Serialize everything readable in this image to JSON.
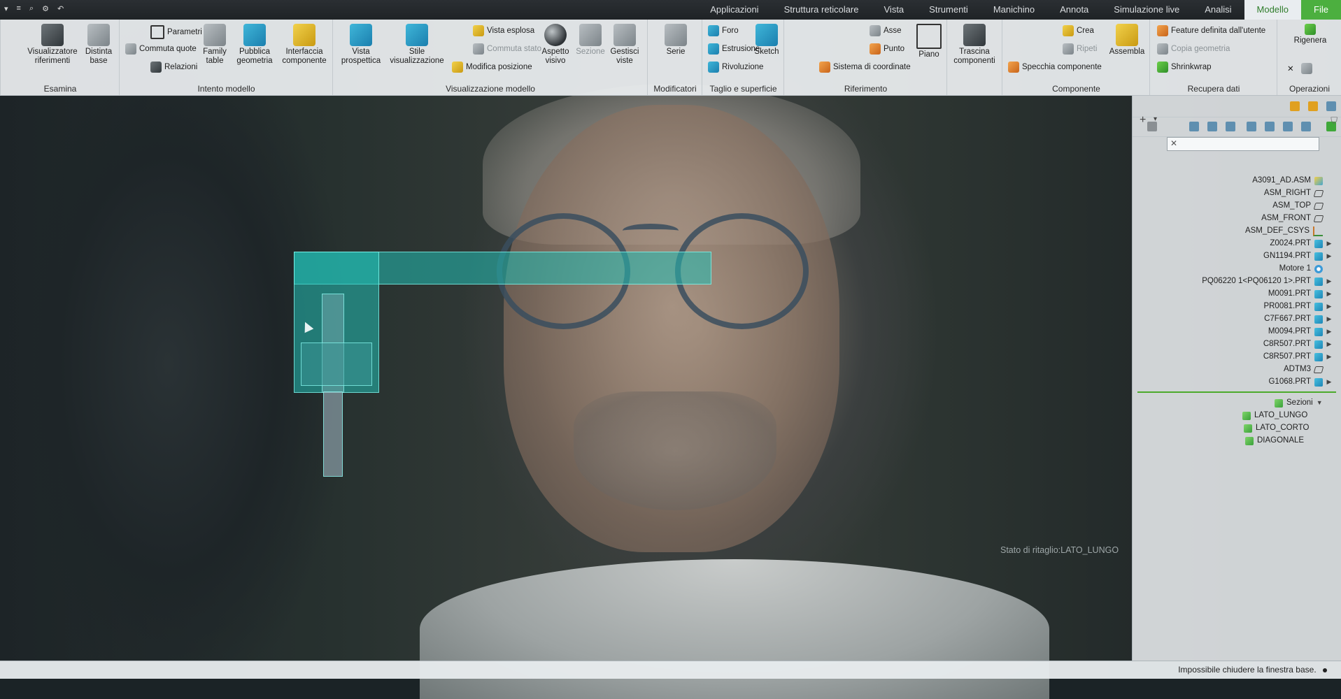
{
  "quick_access": {
    "icons": [
      "chevron-icon",
      "menu-icon",
      "search-icon",
      "settings-icon",
      "undo-icon"
    ]
  },
  "tabs": [
    {
      "label": "File",
      "state": "file"
    },
    {
      "label": "Modello",
      "state": "active"
    },
    {
      "label": "Analisi"
    },
    {
      "label": "Simulazione live"
    },
    {
      "label": "Annota"
    },
    {
      "label": "Manichino"
    },
    {
      "label": "Strumenti"
    },
    {
      "label": "Vista"
    },
    {
      "label": "Struttura reticolare"
    },
    {
      "label": "Applicazioni"
    }
  ],
  "ribbon": {
    "operazioni": {
      "label": "Operazioni",
      "rigenera": "Rigenera"
    },
    "recupera_dati": {
      "label": "Recupera dati",
      "feature_utente": "Feature definita dall'utente",
      "copia_geometria": "Copia geometria",
      "shrinkwrap": "Shrinkwrap"
    },
    "componente": {
      "label": "Componente",
      "assembla": "Assembla",
      "crea": "Crea",
      "ripeti": "Ripeti",
      "specchia": "Specchia componente",
      "trascina": "Trascina componenti"
    },
    "riferimento": {
      "label": "Riferimento",
      "piano": "Piano",
      "asse": "Asse",
      "punto": "Punto",
      "sistema_coordinate": "Sistema di coordinate"
    },
    "taglio_superficie": {
      "label": "Taglio e superficie",
      "sketch": "Sketch",
      "foro": "Foro",
      "estrusione": "Estrusione",
      "rivoluzione": "Rivoluzione"
    },
    "modificatori": {
      "label": "Modificatori",
      "serie": "Serie"
    },
    "visualizzazione_modello": {
      "label": "Visualizzazione modello",
      "gestisci_viste": "Gestisci viste",
      "sezione": "Sezione",
      "aspetto_visivo": "Aspetto visivo",
      "vista_esplosa": "Vista esplosa",
      "commuta_stato": "Commuta stato",
      "modifica_posizione": "Modifica posizione",
      "stile_visualizzazione": "Stile visualizzazione",
      "vista_prospettica": "Vista prospettica"
    },
    "intento_modello": {
      "label": "Intento modello",
      "interfaccia": "Interfaccia componente",
      "pubblica_geometria": "Pubblica geometria",
      "family_table": "Family table",
      "parametri": "Parametri",
      "commuta_quote": "Commuta quote",
      "relazioni": "Relazioni"
    },
    "esamina": {
      "label": "Esamina",
      "distinta_base": "Distinta base",
      "visualizzatore_riferimenti": "Visualizzatore riferimenti"
    }
  },
  "tree": {
    "search_value": "",
    "items": [
      {
        "label": "A3091_AD.ASM",
        "icon": "asm",
        "exp": ""
      },
      {
        "label": "ASM_RIGHT",
        "icon": "plane",
        "exp": ""
      },
      {
        "label": "ASM_TOP",
        "icon": "plane",
        "exp": ""
      },
      {
        "label": "ASM_FRONT",
        "icon": "plane",
        "exp": ""
      },
      {
        "label": "ASM_DEF_CSYS",
        "icon": "csys",
        "exp": ""
      },
      {
        "label": "Z0024.PRT",
        "icon": "part",
        "exp": "▶"
      },
      {
        "label": "GN1194.PRT",
        "icon": "part",
        "exp": "▶"
      },
      {
        "label": "Motore 1",
        "icon": "motor",
        "exp": ""
      },
      {
        "label": "PQ06220 1<PQ06120 1>.PRT",
        "icon": "part",
        "exp": "▶"
      },
      {
        "label": "M0091.PRT",
        "icon": "part",
        "exp": "▶"
      },
      {
        "label": "PR0081.PRT",
        "icon": "part",
        "exp": "▶"
      },
      {
        "label": "C7F667.PRT",
        "icon": "part",
        "exp": "▶"
      },
      {
        "label": "M0094.PRT",
        "icon": "part",
        "exp": "▶"
      },
      {
        "label": "C8R507.PRT",
        "icon": "part",
        "exp": "▶"
      },
      {
        "label": "C8R507.PRT",
        "icon": "part",
        "exp": "▶"
      },
      {
        "label": "ADTM3",
        "icon": "plane",
        "exp": ""
      },
      {
        "label": "G1068.PRT",
        "icon": "part",
        "exp": "▶"
      }
    ],
    "sections_header": "Sezioni",
    "sections": [
      "LATO_LUNGO",
      "LATO_CORTO",
      "DIAGONALE"
    ]
  },
  "viewport": {
    "section_state": "Stato di ritaglio:LATO_LUNGO"
  },
  "status": {
    "message": "Impossibile chiudere la finestra base."
  },
  "colors": {
    "accent": "#4caf3f",
    "ribbon_bg": "#eceff1",
    "model": "#23beb4"
  }
}
